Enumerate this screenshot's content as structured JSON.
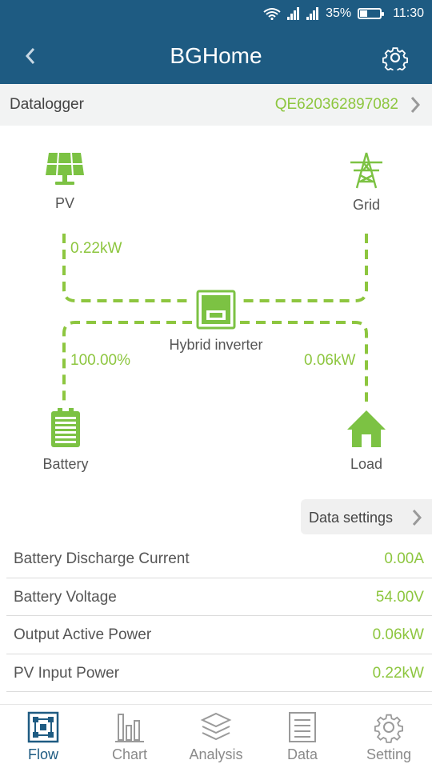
{
  "status": {
    "battery_pct": "35%",
    "time": "11:30",
    "battery_level": 0.35
  },
  "header": {
    "title": "BGHome"
  },
  "datalogger": {
    "label": "Datalogger",
    "serial": "QE620362897082"
  },
  "flow": {
    "pv": {
      "label": "PV",
      "power": "0.22kW"
    },
    "grid": {
      "label": "Grid"
    },
    "inverter": {
      "label": "Hybrid inverter"
    },
    "battery": {
      "label": "Battery",
      "soc": "100.00%"
    },
    "load": {
      "label": "Load",
      "power": "0.06kW"
    }
  },
  "data_settings": {
    "label": "Data settings"
  },
  "rows": [
    {
      "key": "Battery Discharge Current",
      "value": "0.00A"
    },
    {
      "key": "Battery Voltage",
      "value": "54.00V"
    },
    {
      "key": "Output Active Power",
      "value": "0.06kW"
    },
    {
      "key": "PV Input Power",
      "value": "0.22kW"
    }
  ],
  "nav": [
    {
      "label": "Flow",
      "icon": "flow-icon"
    },
    {
      "label": "Chart",
      "icon": "chart-icon"
    },
    {
      "label": "Analysis",
      "icon": "analysis-icon"
    },
    {
      "label": "Data",
      "icon": "data-icon"
    },
    {
      "label": "Setting",
      "icon": "setting-icon"
    }
  ],
  "colors": {
    "header": "#1e5b82",
    "accent": "#8dc63f",
    "flow_green": "#7cc243"
  }
}
